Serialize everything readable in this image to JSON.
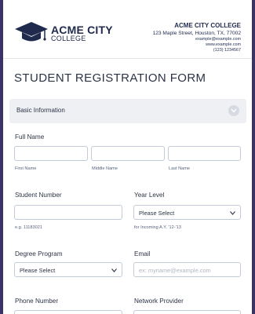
{
  "header": {
    "logo_title": "ACME CITY",
    "logo_subtitle": "COLLEGE",
    "college_name": "ACME CITY COLLEGE",
    "address": "123 Maple Street, Houston, TX, 77002",
    "email": "example@example.com",
    "website": "www.example.com",
    "phone": "(123) 1234567"
  },
  "form": {
    "title": "STUDENT REGISTRATION FORM",
    "section_label": "Basic Information",
    "full_name": {
      "label": "Full Name",
      "first": "First Name",
      "middle": "Middle Name",
      "last": "Last Name"
    },
    "student_number": {
      "label": "Student Number",
      "hint": "e.g. 11183021"
    },
    "year_level": {
      "label": "Year Level",
      "value": "Please Select",
      "hint": "for Incoming A.Y. '12-'13"
    },
    "degree_program": {
      "label": "Degree Program",
      "value": "Please Select"
    },
    "email": {
      "label": "Email",
      "placeholder": "ex: myname@example.com"
    },
    "phone_label": "Phone Number",
    "network_label": "Network Provider"
  },
  "colors": {
    "background": "#3a3466",
    "brand": "#1f2a4d",
    "section_bar": "#eef0f4"
  },
  "icons": {
    "logo": "graduation-cap-icon",
    "section_toggle": "chevron-down-icon",
    "select_arrow": "chevron-down-icon"
  }
}
